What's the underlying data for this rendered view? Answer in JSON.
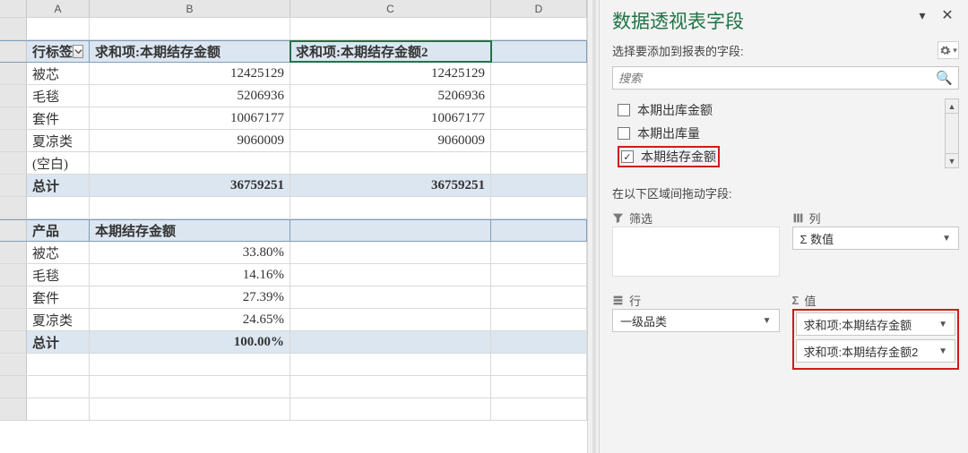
{
  "columns": [
    "A",
    "B",
    "C",
    "D"
  ],
  "pivot1": {
    "headers": {
      "row_label": "行标签",
      "sum1": "求和项:本期结存金额",
      "sum2": "求和项:本期结存金额2"
    },
    "rows": [
      {
        "label": "被芯",
        "v1": "12425129",
        "v2": "12425129"
      },
      {
        "label": "毛毯",
        "v1": "5206936",
        "v2": "5206936"
      },
      {
        "label": "套件",
        "v1": "10067177",
        "v2": "10067177"
      },
      {
        "label": "夏凉类",
        "v1": "9060009",
        "v2": "9060009"
      },
      {
        "label": "(空白)",
        "v1": "",
        "v2": ""
      }
    ],
    "total": {
      "label": "总计",
      "v1": "36759251",
      "v2": "36759251"
    }
  },
  "pivot2": {
    "headers": {
      "prod": "产品",
      "amt": "本期结存金额"
    },
    "rows": [
      {
        "label": "被芯",
        "pct": "33.80%"
      },
      {
        "label": "毛毯",
        "pct": "14.16%"
      },
      {
        "label": "套件",
        "pct": "27.39%"
      },
      {
        "label": "夏凉类",
        "pct": "24.65%"
      }
    ],
    "total": {
      "label": "总计",
      "pct": "100.00%"
    }
  },
  "pane": {
    "title": "数据透视表字段",
    "subtitle": "选择要添加到报表的字段:",
    "search_placeholder": "搜索",
    "fields": [
      {
        "label": "本期出库金额",
        "checked": false
      },
      {
        "label": "本期出库量",
        "checked": false
      },
      {
        "label": "本期结存金额",
        "checked": true,
        "highlight": true
      }
    ],
    "drag_hint": "在以下区域间拖动字段:",
    "zones": {
      "filter": "筛选",
      "columns": "列",
      "rows": "行",
      "values": "值",
      "col_chip": "Σ 数值",
      "row_chip": "一级品类",
      "val_chips": [
        "求和项:本期结存金额",
        "求和项:本期结存金额2"
      ]
    }
  }
}
